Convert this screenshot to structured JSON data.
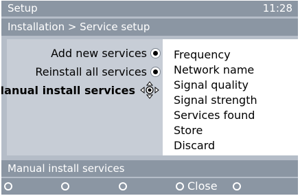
{
  "header": {
    "title": "Setup",
    "time": "11:28"
  },
  "breadcrumb": "Installation > Service setup",
  "menu": {
    "items": [
      {
        "label": "Add new services",
        "selected": false
      },
      {
        "label": "Reinstall all services",
        "selected": false
      },
      {
        "label": "Manual install services",
        "selected": true
      }
    ]
  },
  "submenu": {
    "items": [
      "Frequency",
      "Network name",
      "Signal quality",
      "Signal strength",
      "Services found",
      "Store",
      "Discard"
    ]
  },
  "status": "Manual install services",
  "colors": {
    "bar": "#8b96a3",
    "panel": "#c7cdd6",
    "screen": "#b5bdc8"
  },
  "footer": {
    "keys": [
      {
        "label": ""
      },
      {
        "label": ""
      },
      {
        "label": ""
      },
      {
        "label": "Close"
      },
      {
        "label": ""
      }
    ]
  }
}
